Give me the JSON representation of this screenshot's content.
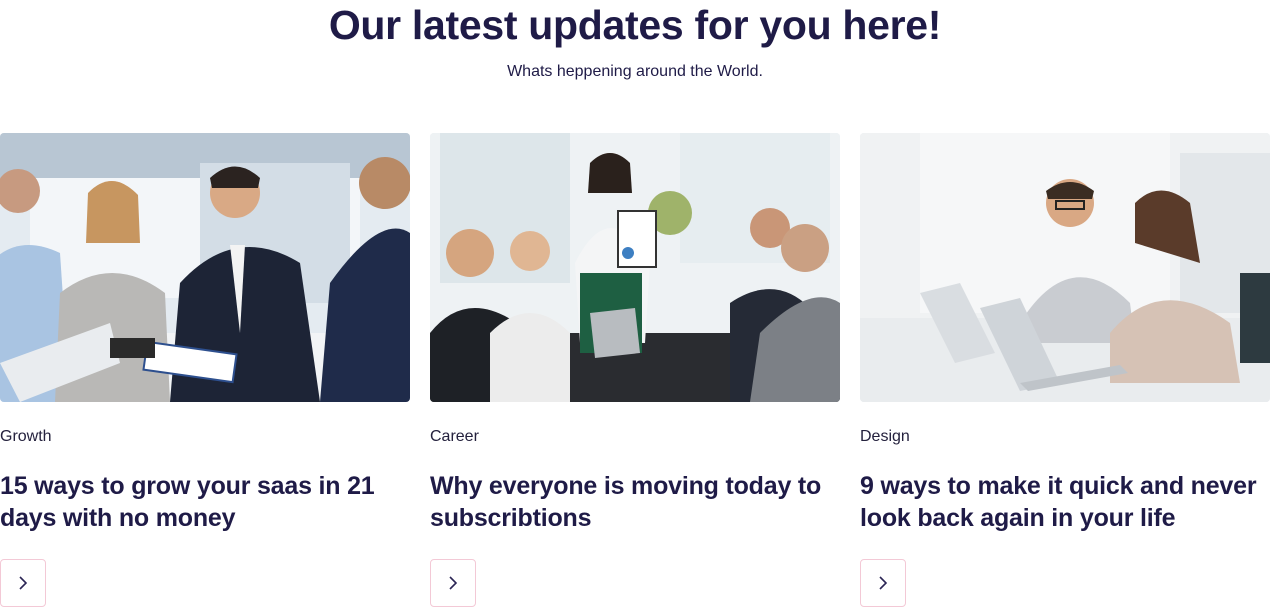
{
  "header": {
    "title": "Our latest updates for you here!",
    "subtitle": "Whats heppening around the World."
  },
  "posts": [
    {
      "category": "Growth",
      "title": "15 ways to grow your saas in 21 days with no money",
      "image_alt": "Business team meeting around a table",
      "button_icon": "chevron-right-icon"
    },
    {
      "category": "Career",
      "title": "Why everyone is moving today to subscribtions",
      "image_alt": "Woman presenting a chart to colleagues",
      "button_icon": "chevron-right-icon"
    },
    {
      "category": "Design",
      "title": "9 ways to make it quick and never look back again in your life",
      "image_alt": "Two colleagues working on laptops",
      "button_icon": "chevron-right-icon"
    }
  ],
  "colors": {
    "heading": "#1f1b47",
    "button_border": "#f3c9d6",
    "chevron": "#2b2555"
  }
}
